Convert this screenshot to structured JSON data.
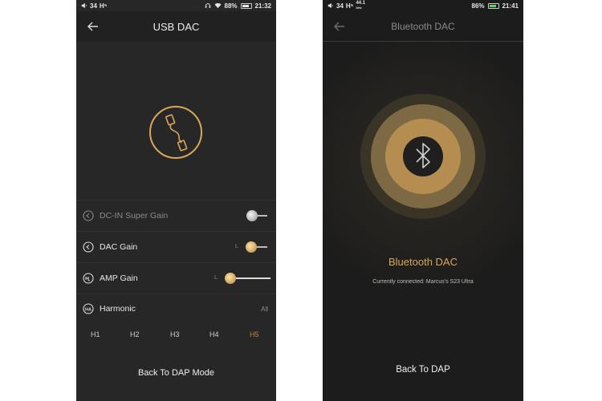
{
  "usb_screen": {
    "status": {
      "signal": "34",
      "network": "H⁵",
      "battery": "88%",
      "time": "21:32",
      "battery_level": 0.88
    },
    "title": "USB DAC",
    "rows": {
      "dc_in_super_gain": {
        "label": "DC-IN Super Gain"
      },
      "dac_gain": {
        "label": "DAC Gain",
        "channel": "L"
      },
      "amp_gain": {
        "label": "AMP Gain",
        "channel": "L"
      },
      "harmonic": {
        "label": "Harmonic",
        "value": "All"
      }
    },
    "harmonics": [
      "H1",
      "H2",
      "H3",
      "H4",
      "H5"
    ],
    "selected_harmonic": "H5",
    "back_button": "Back To DAP Mode"
  },
  "bt_screen": {
    "status": {
      "signal": "34",
      "network": "H⁵",
      "rate_top": "44.1",
      "rate_bottom": "kHz",
      "battery": "86%",
      "time": "21:41",
      "battery_level": 0.86
    },
    "title": "Bluetooth DAC",
    "heading": "Bluetooth DAC",
    "connected": "Currently connected: Marcus's S23 Ultra",
    "back_button": "Back To DAP"
  },
  "colors": {
    "accent": "#d9a75a",
    "accent_dark": "#c48a35",
    "background": "#272727"
  },
  "icons": [
    "volume-icon",
    "headphones-icon",
    "wifi-icon",
    "battery-icon",
    "back-arrow-icon",
    "usb-cable-icon",
    "gain-icon",
    "amp-icon",
    "ha-icon",
    "bluetooth-icon"
  ]
}
